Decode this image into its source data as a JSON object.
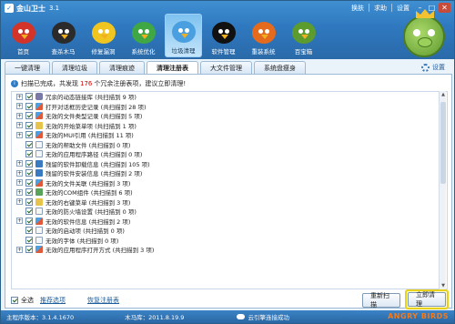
{
  "app": {
    "title": "金山卫士",
    "version": "3.1"
  },
  "topbar": {
    "items": [
      "换肤",
      "求助",
      "设置"
    ]
  },
  "nav": {
    "items": [
      {
        "label": "首页",
        "color": "#d3342a"
      },
      {
        "label": "查杀木马",
        "color": "#2b2b2b"
      },
      {
        "label": "修复漏洞",
        "color": "#f0c520"
      },
      {
        "label": "系统优化",
        "color": "#3fa844"
      },
      {
        "label": "垃圾清理",
        "color": "#4a9fe0",
        "active": true
      },
      {
        "label": "软件管理",
        "color": "#111111"
      },
      {
        "label": "重装系统",
        "color": "#e46a1d"
      },
      {
        "label": "百宝箱",
        "color": "#5c9c2e"
      }
    ]
  },
  "tabs": [
    {
      "label": "一键清理"
    },
    {
      "label": "清理垃圾"
    },
    {
      "label": "清理痕迹"
    },
    {
      "label": "清理注册表",
      "active": true
    },
    {
      "label": "大文件管理"
    },
    {
      "label": "系统盘瘦身"
    }
  ],
  "settings_label": "设置",
  "status": {
    "prefix": "扫描已完成，共发现",
    "count": "176",
    "suffix": "个冗余注册表项，建议立即清理!"
  },
  "list": [
    {
      "label": "冗余的动态链接库 (共扫描到 9 项)",
      "icon": "dll",
      "expand": "+"
    },
    {
      "label": "打开对话框历史记录 (共扫描到 28 项)",
      "icon": "reg",
      "expand": "+"
    },
    {
      "label": "无效的文件类型记录 (共扫描到 5 项)",
      "icon": "reg",
      "expand": "+"
    },
    {
      "label": "无效的开始菜单项 (共扫描到 1 项)",
      "icon": "menu",
      "expand": "+"
    },
    {
      "label": "无效的MUI引用 (共扫描到 11 项)",
      "icon": "reg",
      "expand": "+"
    },
    {
      "label": "无效的帮助文件 (共扫描到 0 项)",
      "icon": "file",
      "expand": ""
    },
    {
      "label": "无效的应用程序路径 (共扫描到 0 项)",
      "icon": "file",
      "expand": ""
    },
    {
      "label": "残留的软件卸载信息 (共扫描到 105 项)",
      "icon": "app",
      "expand": "+"
    },
    {
      "label": "残留的软件安装信息 (共扫描到 2 项)",
      "icon": "app",
      "expand": "+"
    },
    {
      "label": "无效的文件关联 (共扫描到 3 项)",
      "icon": "reg",
      "expand": "+"
    },
    {
      "label": "无效的COM组件 (共扫描到 6 项)",
      "icon": "com",
      "expand": "+"
    },
    {
      "label": "无效的右键菜单 (共扫描到 3 项)",
      "icon": "menu",
      "expand": "+"
    },
    {
      "label": "无效的防火墙设置 (共扫描到 0 项)",
      "icon": "file",
      "expand": ""
    },
    {
      "label": "无效的软件信息 (共扫描到 2 项)",
      "icon": "reg",
      "expand": "+"
    },
    {
      "label": "无效的启动项 (共扫描到 0 项)",
      "icon": "file",
      "expand": ""
    },
    {
      "label": "无效的字体 (共扫描到 0 项)",
      "icon": "file",
      "expand": ""
    },
    {
      "label": "无效的应用程序打开方式 (共扫描到 3 项)",
      "icon": "reg",
      "expand": "+"
    }
  ],
  "bottom": {
    "select_all": "全选",
    "recommended": "推荐选项",
    "restore": "恢复注册表",
    "rescan": "重新扫描",
    "clean_now": "立即清理"
  },
  "statusbar": {
    "main_version": "主程序版本：3.1.4.1670",
    "trojan_db": "木马库：2011.8.19.9",
    "cloud": "云引擎连接成功",
    "brand": "ANGRY BIRDS"
  }
}
